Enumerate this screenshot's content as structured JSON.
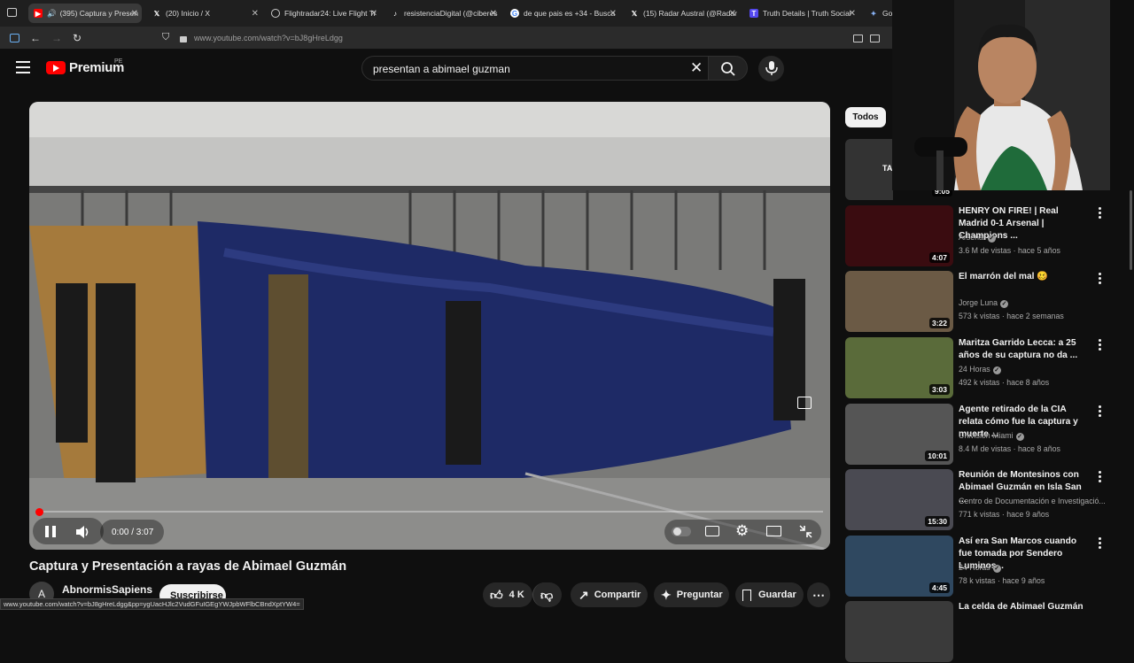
{
  "browser": {
    "tabs": [
      {
        "label": "(395) Captura y Presen",
        "active": true
      },
      {
        "label": "(20) Inicio / X"
      },
      {
        "label": "Flightradar24: Live Flight Tr"
      },
      {
        "label": "resistenciaDigital (@ciberes"
      },
      {
        "label": "de que pais es +34 - Busca"
      },
      {
        "label": "(15) Radar Austral (@Radar"
      },
      {
        "label": "Truth Details | Truth Social"
      },
      {
        "label": "Goo"
      }
    ],
    "url": "www.youtube.com/watch?v=bJ8gHreLdgg",
    "status_url": "www.youtube.com/watch?v=bJ8gHreLdgg&pp=ygUacHJlc2VudGFuIGEgYWJpbWFlbCBndXptYW4="
  },
  "header": {
    "logo_text": "Premium",
    "country_code": "PE",
    "search_value": "presentan a abimael guzman"
  },
  "player": {
    "time": "0:00 / 3:07",
    "progress_fraction": 0.0
  },
  "video": {
    "title": "Captura y Presentación a rayas de Abimael Guzmán",
    "channel": "AbnormisSapiens",
    "channel_initial": "A",
    "subscribe_label": "Suscribirse",
    "likes": "4 K",
    "share_label": "Compartir",
    "ask_label": "Preguntar",
    "save_label": "Guardar"
  },
  "sidebar": {
    "chip": "Todos",
    "first_duration": "9:05",
    "recs": [
      {
        "title": "HENRY ON FIRE! | Real Madrid 0-1 Arsenal | Champions ...",
        "channel": "Arsenal",
        "verified": true,
        "meta": "3.6 M de vistas · hace 5 años",
        "duration": "4:07",
        "color": "#3a0c10"
      },
      {
        "title": "El marrón del mal 🥴",
        "channel": "Jorge Luna",
        "verified": true,
        "meta": "573 k vistas · hace 2 semanas",
        "duration": "3:22",
        "color": "#6b5a45"
      },
      {
        "title": "Maritza Garrido Lecca: a 25 años de su captura no da ...",
        "channel": "24 Horas",
        "verified": true,
        "meta": "492 k vistas · hace 8 años",
        "duration": "3:03",
        "color": "#5a6b3a"
      },
      {
        "title": "Agente retirado de la CIA relata cómo fue la captura y muerte ...",
        "channel": "Univision Miami",
        "verified": true,
        "meta": "8.4 M de vistas · hace 8 años",
        "duration": "10:01",
        "color": "#555555"
      },
      {
        "title": "Reunión de Montesinos con Abimael Guzmán en Isla San ...",
        "channel": "Centro de Documentación e Investigació...",
        "verified": false,
        "meta": "771 k vistas · hace 9 años",
        "duration": "15:30",
        "color": "#4a4a52"
      },
      {
        "title": "Así era San Marcos cuando fue tomada por Sendero Luminos...",
        "channel": "24 Horas",
        "verified": true,
        "meta": "78 k vistas · hace 9 años",
        "duration": "4:45",
        "color": "#2f4860"
      },
      {
        "title": "La celda de Abimael Guzmán",
        "channel": "",
        "verified": false,
        "meta": "",
        "duration": "",
        "color": "#3a3a3a"
      }
    ]
  }
}
